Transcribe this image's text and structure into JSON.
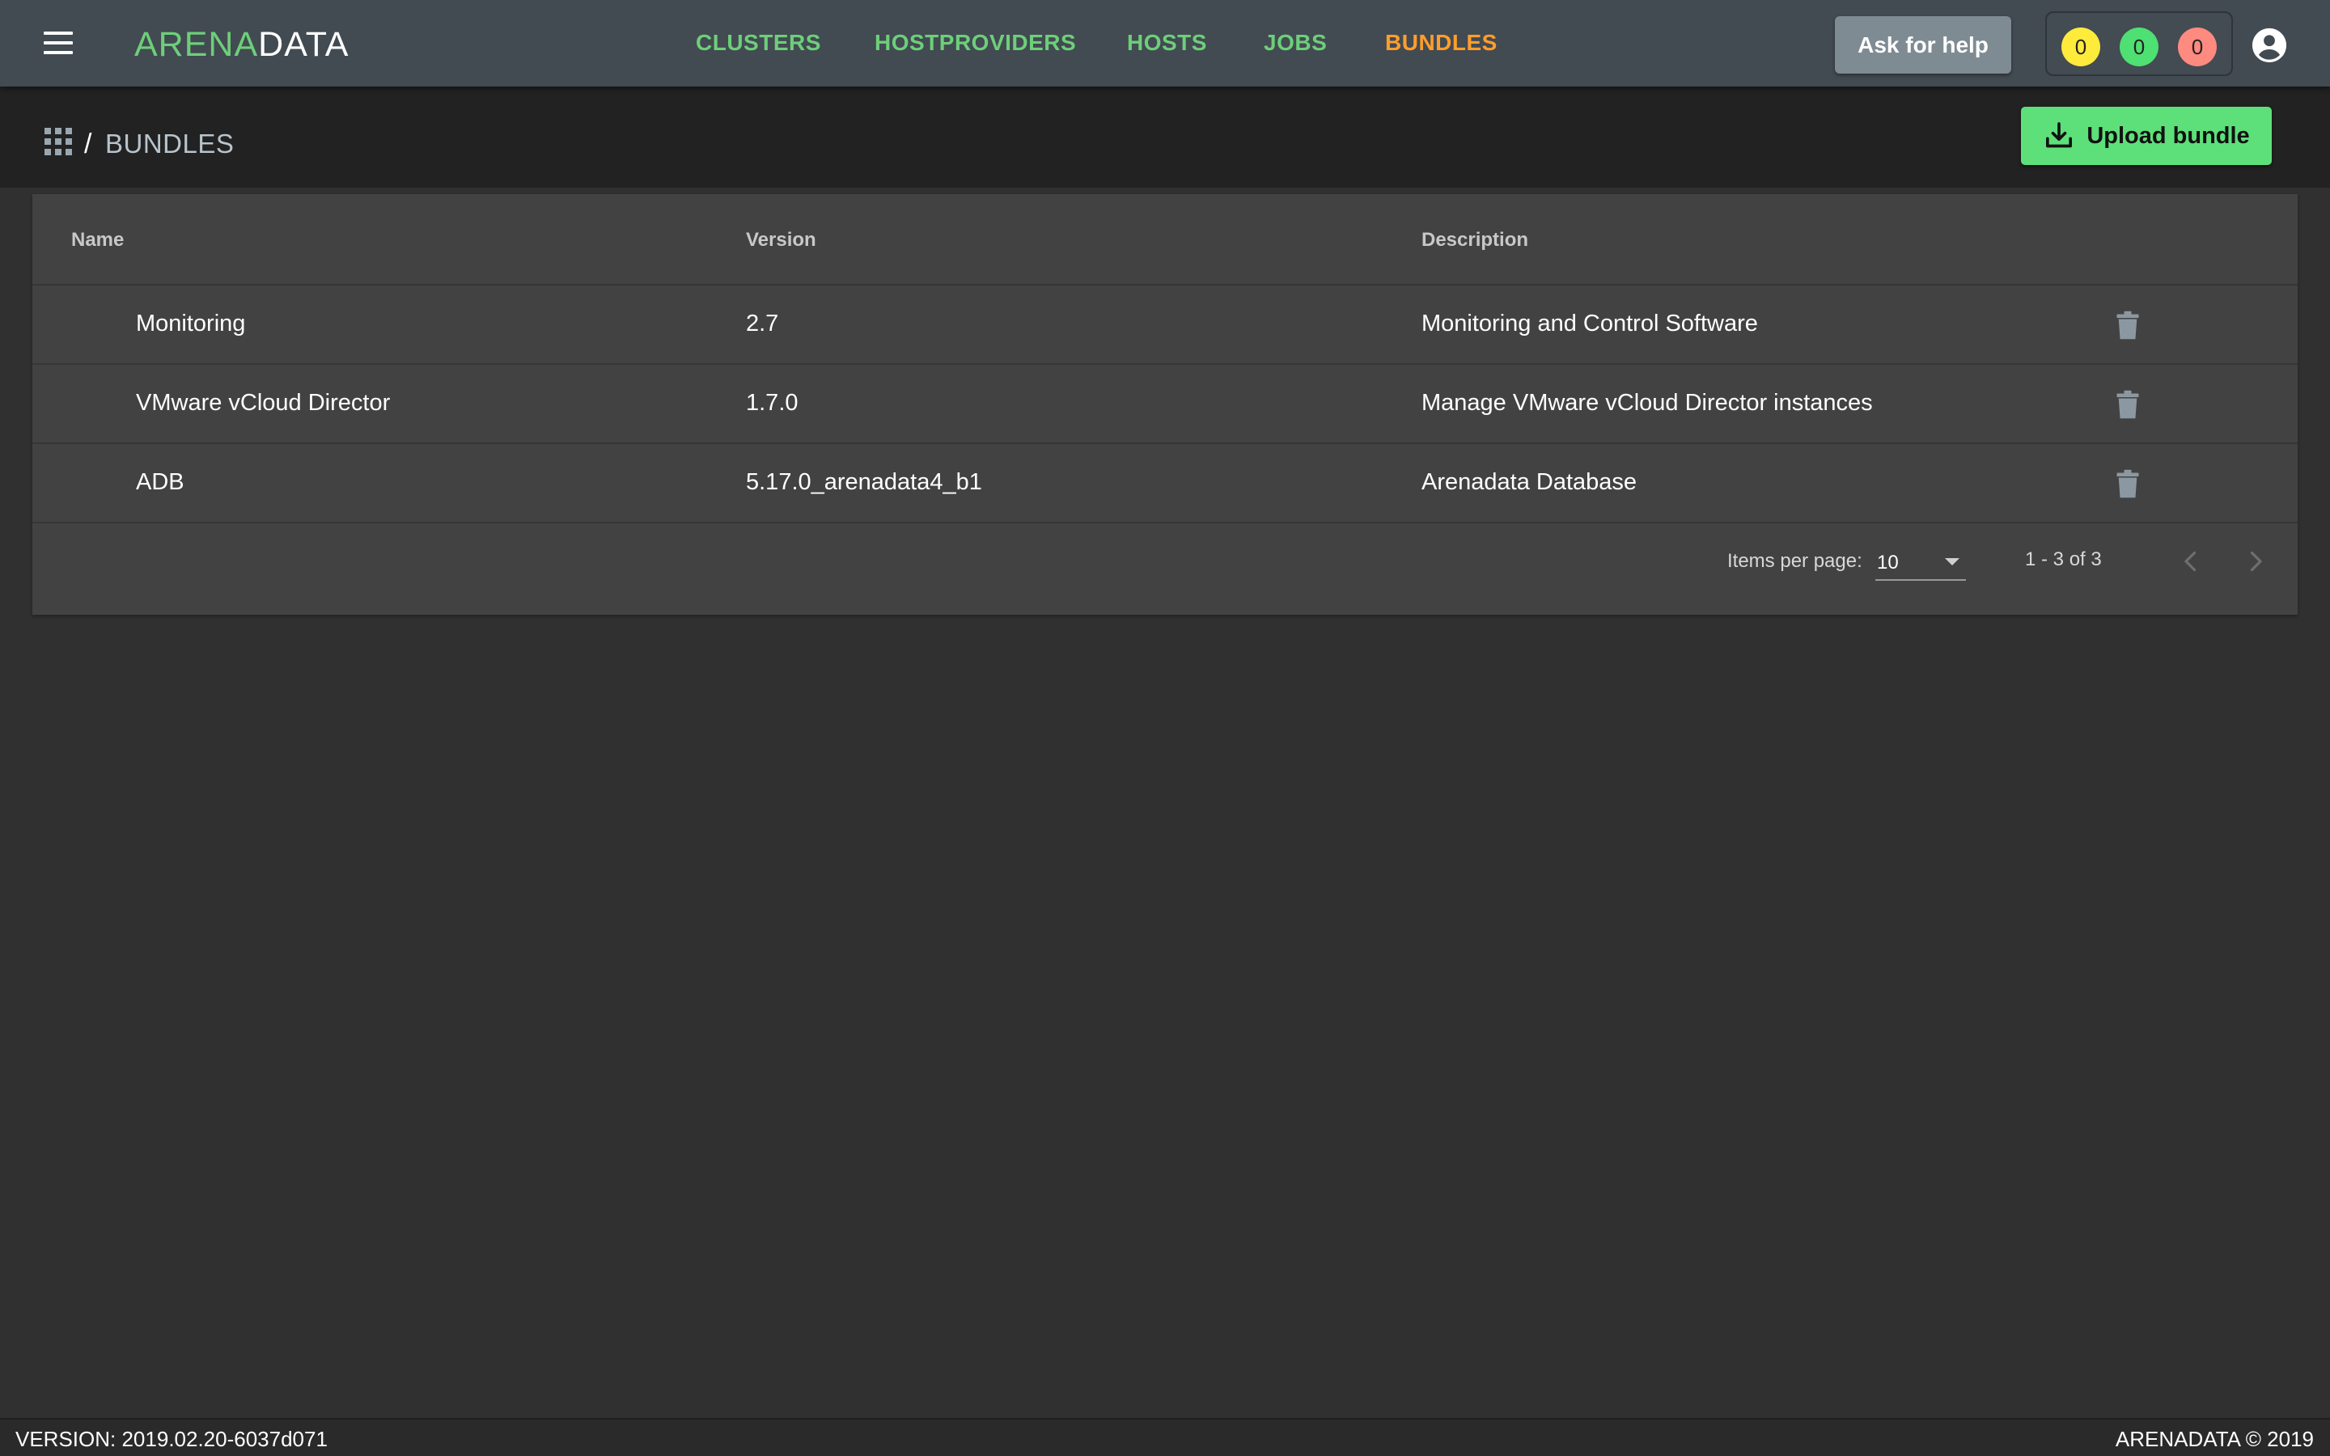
{
  "header": {
    "logo_part1": "ARENA",
    "logo_part2": "DATA",
    "nav": [
      {
        "label": "CLUSTERS",
        "active": false
      },
      {
        "label": "HOSTPROVIDERS",
        "active": false
      },
      {
        "label": "HOSTS",
        "active": false
      },
      {
        "label": "JOBS",
        "active": false
      },
      {
        "label": "BUNDLES",
        "active": true
      }
    ],
    "help_label": "Ask for help",
    "counters": [
      {
        "value": "0",
        "color": "#ffeb3b"
      },
      {
        "value": "0",
        "color": "#4ee072"
      },
      {
        "value": "0",
        "color": "#ff8a80"
      }
    ],
    "icons": {
      "menu": "menu-icon",
      "user": "account-circle-icon"
    }
  },
  "breadcrumb": {
    "icon": "apps-grid-icon",
    "separator": "/",
    "current": "BUNDLES"
  },
  "actions": {
    "upload_label": "Upload bundle",
    "upload_icon": "download-icon"
  },
  "table": {
    "columns": [
      "Name",
      "Version",
      "Description"
    ],
    "rows": [
      {
        "name": "Monitoring",
        "version": "2.7",
        "description": "Monitoring and Control Software"
      },
      {
        "name": "VMware vCloud Director",
        "version": "1.7.0",
        "description": "Manage VMware vCloud Director instances"
      },
      {
        "name": "ADB",
        "version": "5.17.0_arenadata4_b1",
        "description": "Arenadata Database"
      }
    ],
    "row_action_icon": "delete-icon"
  },
  "paginator": {
    "items_per_page_label": "Items per page:",
    "items_per_page_value": "10",
    "range_label": "1 - 3 of 3"
  },
  "footer": {
    "version": "VERSION: 2019.02.20-6037d071",
    "copyright": "ARENADATA © 2019"
  },
  "colors": {
    "accent_green": "#6dcf79",
    "active_orange": "#ff9e2c",
    "upload_green": "#5de07a"
  }
}
